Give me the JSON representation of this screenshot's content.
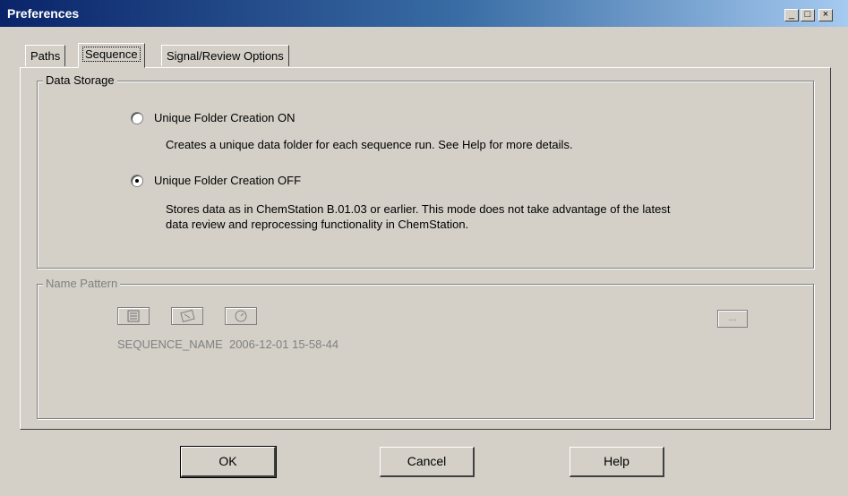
{
  "window": {
    "title": "Preferences",
    "minimize_icon": "_",
    "maximize_icon": "□",
    "close_icon": "×"
  },
  "tabs": [
    {
      "label": "Paths"
    },
    {
      "label": "Sequence"
    },
    {
      "label": "Signal/Review Options"
    }
  ],
  "data_storage": {
    "legend": "Data Storage",
    "option_on": {
      "label": "Unique Folder Creation ON",
      "selected": false,
      "description": "Creates a unique data folder for each sequence run. See Help for more details."
    },
    "option_off": {
      "label": "Unique Folder Creation OFF",
      "selected": true,
      "description_line1": "Stores data as in ChemStation B.01.03 or earlier. This mode does not take advantage of the latest",
      "description_line2": "data review and reprocessing functionality in ChemStation."
    }
  },
  "name_pattern": {
    "legend": "Name Pattern",
    "icons": [
      "sequence-name-icon",
      "operator-icon",
      "date-time-icon"
    ],
    "browse_label": "...",
    "preview": "SEQUENCE_NAME  2006-12-01 15-58-44",
    "enabled": false
  },
  "buttons": {
    "ok": "OK",
    "cancel": "Cancel",
    "help": "Help"
  }
}
